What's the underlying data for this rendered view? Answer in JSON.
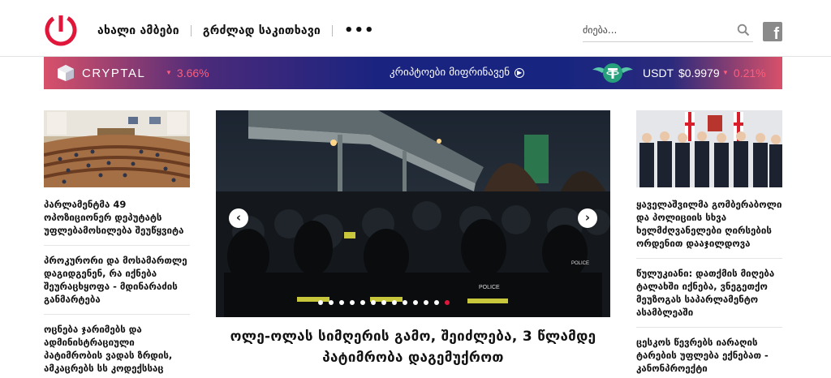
{
  "header": {
    "nav": [
      "ახალი ამბები",
      "გრძლად საკითხავი"
    ],
    "more_label": "•••",
    "search_placeholder": "ძიება..."
  },
  "banner": {
    "brand": "CRYPTAL",
    "brand_change": "3.66%",
    "link_label": "კრიპტოები მიფრინავენ",
    "coin_name": "USDT",
    "coin_price": "$0.9979",
    "coin_change": "0.21%",
    "negative_color": "#ff5d7a"
  },
  "left_column": {
    "stories": [
      "პარლამენტმა 49 ოპოზიციონერ დეპუტატს უფლებამოსილება შეუწყვიტა",
      "პროკურორი და მოსამართლე დაგიდგენენ, რა იქნება შეურაცხყოფა - მდინარაძის განმარტება",
      "ოცნება ჯარიმებს და ადმინისტრაციული პატიმრობის ვადას ზრდის, ამკაცრებს სს კოდექსსაც"
    ]
  },
  "main": {
    "title": "ოლე-ოლას სიმღერის გამო, შეიძლება, 3 წლამდე პატიმრობა დაგემუქროთ",
    "dot_count": 13,
    "active_dot": 12,
    "accent": "#e0163a",
    "patch_text": "POLICE"
  },
  "right_column": {
    "stories": [
      "ყაველაშვილმა გომბერაბოლი და პოლიციის სხვა ხელმძღვანელები ღირსების ორდენით დააჯილდოვა",
      "წულუკიანი: დათქმის მიღება ტალახში იქნება, ვნეგეთქო მეუზოგას საპარლამენტო ასამბლეაში",
      "ცესკოს წევრებს იარაღის ტარების უფლება ექნებათ - კანონპროექტი"
    ]
  }
}
